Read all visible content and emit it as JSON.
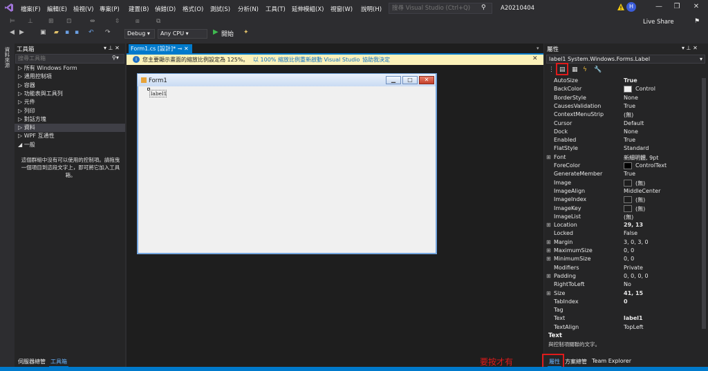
{
  "menu": [
    "檔案(F)",
    "編輯(E)",
    "檢視(V)",
    "專案(P)",
    "建置(B)",
    "偵錯(D)",
    "格式(O)",
    "測試(S)",
    "分析(N)",
    "工具(T)",
    "延伸模組(X)",
    "視窗(W)",
    "說明(H)"
  ],
  "search_placeholder": "搜尋 Visual Studio (Ctrl+Q)",
  "solution_name": "A20210404",
  "avatar_initial": "H",
  "window_controls": [
    "—",
    "❐",
    "✕"
  ],
  "live_share": "Live Share",
  "toolbar": {
    "config": "Debug",
    "platform": "Any CPU",
    "start": "開始"
  },
  "left_strip_label": "資料來源",
  "toolbox": {
    "title": "工具箱",
    "search_placeholder": "搜尋工具箱",
    "categories": [
      "▷ 所有 Windows Form",
      "▷ 通用控制項",
      "▷ 容器",
      "▷ 功能表與工具列",
      "▷ 元件",
      "▷ 列印",
      "▷ 對話方塊",
      "▷ 資料",
      "▷ WPF 互通性",
      "◢ 一般"
    ],
    "selected_index": 7,
    "empty_message": "這個群組中沒有可以使用的控制項。請拖曳一個項目到這段文字上，即可將它加入工具箱。"
  },
  "bottom_tabs_left": [
    "伺服器總管",
    "工具箱"
  ],
  "editor": {
    "doc_tab": "Form1.cs [設計]*",
    "info_message": "您主要顯示畫面的縮放比例設定為 125%。",
    "info_link1": "以 100% 縮放比例重新啟動 Visual Studio",
    "info_link2": "協助我決定"
  },
  "form": {
    "title": "Form1",
    "label_text": "label1"
  },
  "properties": {
    "title": "屬性",
    "object": "label1  System.Windows.Forms.Label",
    "rows": [
      {
        "name": "AutoSize",
        "value": "True",
        "bold": true
      },
      {
        "name": "BackColor",
        "value": "Control",
        "swatch": "#f0f0f0"
      },
      {
        "name": "BorderStyle",
        "value": "None"
      },
      {
        "name": "CausesValidation",
        "value": "True"
      },
      {
        "name": "ContextMenuStrip",
        "value": "(無)"
      },
      {
        "name": "Cursor",
        "value": "Default"
      },
      {
        "name": "Dock",
        "value": "None"
      },
      {
        "name": "Enabled",
        "value": "True"
      },
      {
        "name": "FlatStyle",
        "value": "Standard"
      },
      {
        "name": "Font",
        "value": "新細明體, 9pt",
        "expand": true
      },
      {
        "name": "ForeColor",
        "value": "ControlText",
        "swatch": "#000000"
      },
      {
        "name": "GenerateMember",
        "value": "True"
      },
      {
        "name": "Image",
        "value": "(無)",
        "swatch": "#1e1e1e"
      },
      {
        "name": "ImageAlign",
        "value": "MiddleCenter"
      },
      {
        "name": "ImageIndex",
        "value": "(無)",
        "swatch": "#1e1e1e"
      },
      {
        "name": "ImageKey",
        "value": "(無)",
        "swatch": "#1e1e1e"
      },
      {
        "name": "ImageList",
        "value": "(無)"
      },
      {
        "name": "Location",
        "value": "29, 13",
        "bold": true,
        "expand": true
      },
      {
        "name": "Locked",
        "value": "False"
      },
      {
        "name": "Margin",
        "value": "3, 0, 3, 0",
        "expand": true
      },
      {
        "name": "MaximumSize",
        "value": "0, 0",
        "expand": true
      },
      {
        "name": "MinimumSize",
        "value": "0, 0",
        "expand": true
      },
      {
        "name": "Modifiers",
        "value": "Private"
      },
      {
        "name": "Padding",
        "value": "0, 0, 0, 0",
        "expand": true
      },
      {
        "name": "RightToLeft",
        "value": "No"
      },
      {
        "name": "Size",
        "value": "41, 15",
        "bold": true,
        "expand": true
      },
      {
        "name": "TabIndex",
        "value": "0",
        "bold": true
      },
      {
        "name": "Tag",
        "value": ""
      },
      {
        "name": "Text",
        "value": "label1",
        "bold": true
      },
      {
        "name": "TextAlign",
        "value": "TopLeft"
      }
    ],
    "desc_title": "Text",
    "desc_text": "與控制項關聯的文字。"
  },
  "bottom_tabs_right": [
    "屬性",
    "方案總管",
    "Team Explorer"
  ],
  "annotation": "要按才有",
  "colors": {
    "accent": "#007acc",
    "highlight": "#e01b1b",
    "info_bar": "#fcf2ba"
  }
}
